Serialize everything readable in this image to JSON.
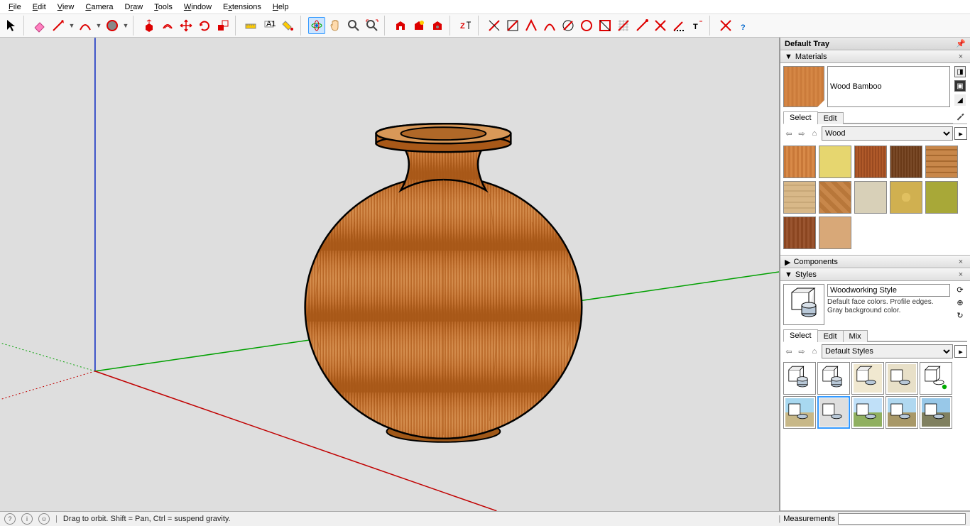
{
  "menu": [
    "File",
    "Edit",
    "View",
    "Camera",
    "Draw",
    "Tools",
    "Window",
    "Extensions",
    "Help"
  ],
  "tray": {
    "title": "Default Tray",
    "materials": {
      "title": "Materials",
      "current_name": "Wood Bamboo",
      "tabs": [
        "Select",
        "Edit"
      ],
      "active_tab": "Select",
      "library": "Wood",
      "swatches": [
        {
          "name": "wood-bamboo",
          "bg": "repeating-linear-gradient(90deg,#c87838 0 3px,#d88a48 3px 6px)"
        },
        {
          "name": "wood-light",
          "bg": "#e6d66f"
        },
        {
          "name": "wood-cherry",
          "bg": "repeating-linear-gradient(90deg,#9a4a20 0 2px,#b05a2a 2px 4px)"
        },
        {
          "name": "wood-dark-grain",
          "bg": "repeating-linear-gradient(90deg,#7a4a28 0 2px,#6a3a18 2px 4px)"
        },
        {
          "name": "wood-floor",
          "bg": "repeating-linear-gradient(0deg,#c8874a 0 6px,#a86a30 6px 8px)"
        },
        {
          "name": "wood-plank-lt",
          "bg": "repeating-linear-gradient(0deg,#d8b888 0 6px,#c8a878 6px 8px)"
        },
        {
          "name": "wood-parquet",
          "bg": "repeating-linear-gradient(45deg,#c8874a 0 6px,#b8773a 6px 12px)"
        },
        {
          "name": "wood-ash",
          "bg": "#d8d0b8"
        },
        {
          "name": "wood-osb",
          "bg": "radial-gradient(#e0c060 20%,#d0b050 20%)"
        },
        {
          "name": "wood-olive",
          "bg": "#a8a838"
        },
        {
          "name": "wood-mahogany",
          "bg": "repeating-linear-gradient(90deg,#8a4520 0 3px,#9a5530 3px 6px)"
        },
        {
          "name": "wood-tan",
          "bg": "#d8a878"
        }
      ]
    },
    "components": {
      "title": "Components"
    },
    "styles": {
      "title": "Styles",
      "current_name": "Woodworking Style",
      "description": "Default face colors. Profile edges. Gray background color.",
      "tabs": [
        "Select",
        "Edit",
        "Mix"
      ],
      "active_tab": "Select",
      "library": "Default Styles"
    }
  },
  "status": {
    "hint": "Drag to orbit. Shift = Pan, Ctrl = suspend gravity.",
    "measurements_label": "Measurements",
    "measurements_value": ""
  }
}
